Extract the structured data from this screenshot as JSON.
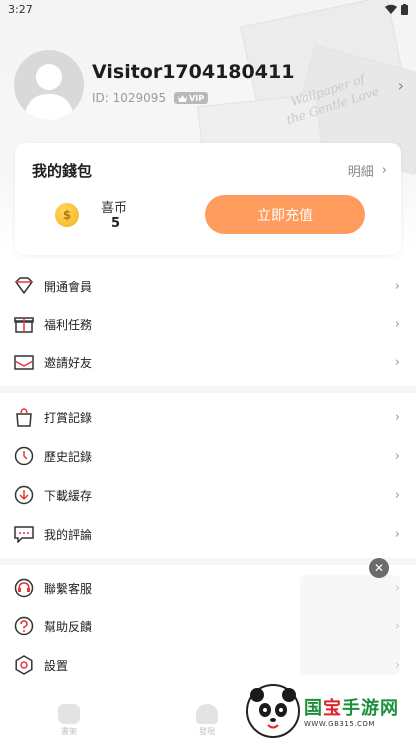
{
  "status_bar": {
    "time": "3:27"
  },
  "profile": {
    "username": "Visitor1704180411",
    "id_text": "ID: 1029095",
    "vip_label": "VIP",
    "bg_text": [
      "Wallpaper of",
      "the Gentle Love"
    ]
  },
  "wallet": {
    "title": "我的錢包",
    "detail_label": "明細",
    "coin_label": "喜币",
    "coin_count": "5",
    "recharge_label": "立即充值",
    "accent_color": "#ff9b5c"
  },
  "menu_groups": [
    [
      {
        "label": "開通會員",
        "icon": "diamond-icon"
      },
      {
        "label": "福利任務",
        "icon": "gift-icon"
      },
      {
        "label": "邀請好友",
        "icon": "envelope-icon"
      }
    ],
    [
      {
        "label": "打賞記錄",
        "icon": "bag-icon"
      },
      {
        "label": "歷史記錄",
        "icon": "clock-icon"
      },
      {
        "label": "下載緩存",
        "icon": "download-icon"
      },
      {
        "label": "我的評論",
        "icon": "comment-icon"
      }
    ],
    [
      {
        "label": "聯繫客服",
        "icon": "headset-icon"
      },
      {
        "label": "幫助反饋",
        "icon": "help-icon"
      },
      {
        "label": "設置",
        "icon": "gear-icon"
      }
    ]
  ],
  "bottom_nav": [
    {
      "label": "書架",
      "icon": "bookshelf-icon"
    },
    {
      "label": "發現",
      "icon": "discover-icon"
    }
  ],
  "watermark": {
    "title_green": "国",
    "title_red": "宝",
    "title_rest": "手游网",
    "url": "WWW.GB315.COM"
  }
}
